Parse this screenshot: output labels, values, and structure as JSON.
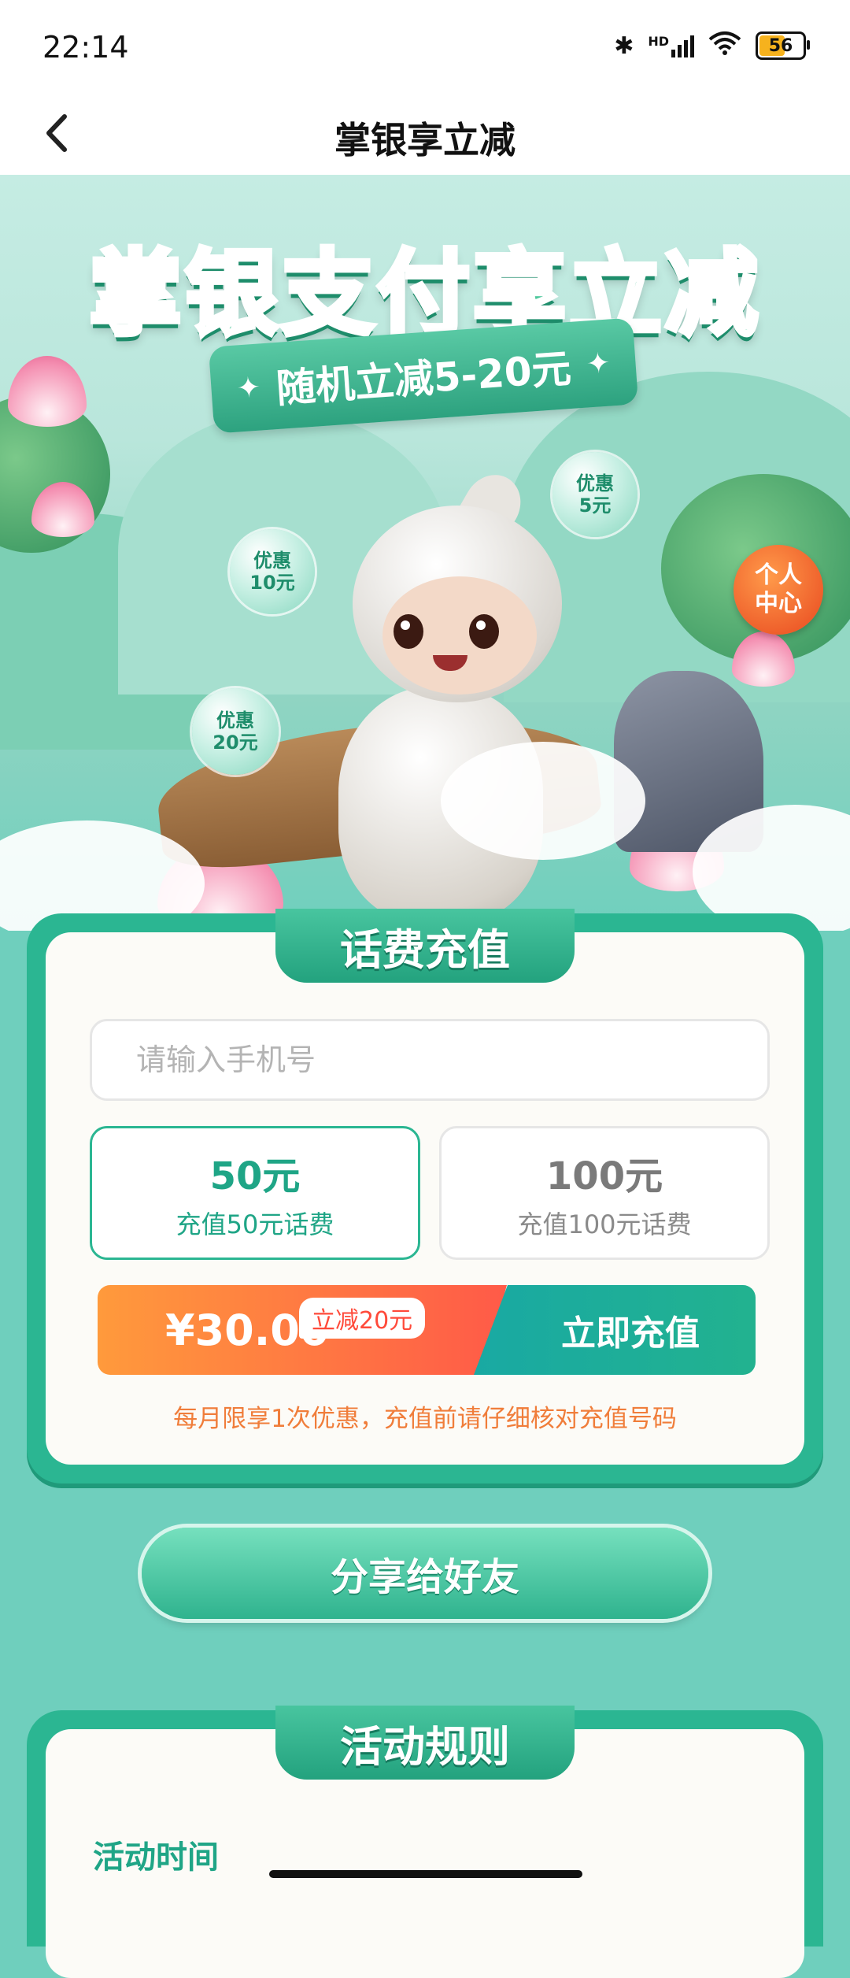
{
  "status_bar": {
    "time": "22:14",
    "network": "HD",
    "battery": "56"
  },
  "header": {
    "title": "掌银享立减"
  },
  "banner": {
    "title": "掌银支付享立减",
    "subtitle": "随机立减5-20元",
    "bubbles": [
      {
        "line1": "优惠",
        "line2": "10元"
      },
      {
        "line1": "优惠",
        "line2": "5元"
      },
      {
        "line1": "优惠",
        "line2": "20元"
      }
    ],
    "personal_center": {
      "line1": "个人",
      "line2": "中心"
    }
  },
  "recharge": {
    "section_title": "话费充值",
    "phone_placeholder": "请输入手机号",
    "options": [
      {
        "amount": "50元",
        "desc": "充值50元话费",
        "selected": true
      },
      {
        "amount": "100元",
        "desc": "充值100元话费",
        "selected": false
      }
    ],
    "price": "¥30.00",
    "discount": "立减20元",
    "submit": "立即充值",
    "notice": "每月限享1次优惠，充值前请仔细核对充值号码"
  },
  "share": {
    "label": "分享给好友"
  },
  "rules": {
    "section_title": "活动规则",
    "first_heading": "活动时间"
  },
  "colors": {
    "primary": "#2bb692",
    "accent_orange": "#ff5a48",
    "page_bg": "#6fcfbd"
  }
}
